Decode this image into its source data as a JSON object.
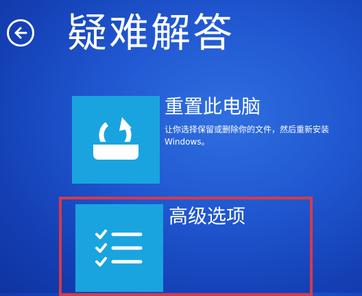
{
  "header": {
    "title": "疑难解答",
    "back_icon": "back-arrow-icon"
  },
  "options": [
    {
      "title": "重置此电脑",
      "description": "让你选择保留或删除你的文件，然后重新安装 Windows。",
      "icon": "reset-pc-icon"
    },
    {
      "title": "高级选项",
      "icon": "checklist-icon"
    }
  ],
  "colors": {
    "background": "#1e50cc",
    "tile": "#1aa4df",
    "highlight_border": "#d73a4a",
    "text": "#ffffff"
  }
}
